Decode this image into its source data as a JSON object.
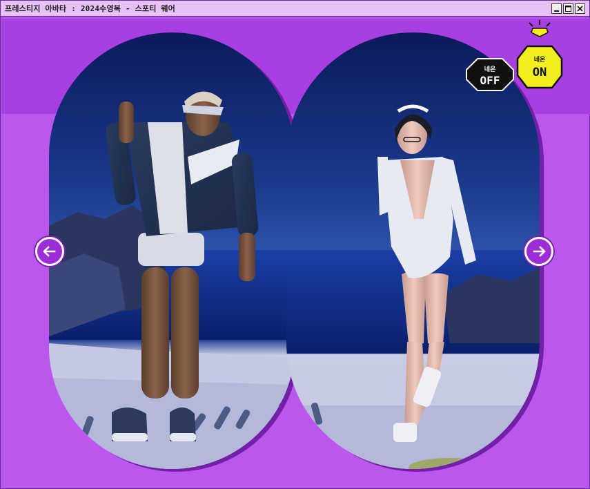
{
  "window": {
    "title": "프레스티지 아바타 : 2024수영복 - 스포티 웨어",
    "minimize_icon": "minimize-icon",
    "maximize_icon": "maximize-icon",
    "close_icon": "close-icon"
  },
  "colors": {
    "background": "#bc57ee",
    "band": "#a83fe0",
    "frame_shadow": "#7320a8",
    "accent_yellow": "#f4ee1e",
    "arrow_fill": "#9b2cd6"
  },
  "controls": {
    "neon_off": {
      "small": "네온",
      "big": "OFF"
    },
    "neon_on": {
      "small": "네온",
      "big": "ON"
    },
    "prev_icon": "arrow-left-icon",
    "next_icon": "arrow-right-icon"
  },
  "preview": {
    "left_avatar": "male-avatar",
    "right_avatar": "female-avatar"
  }
}
